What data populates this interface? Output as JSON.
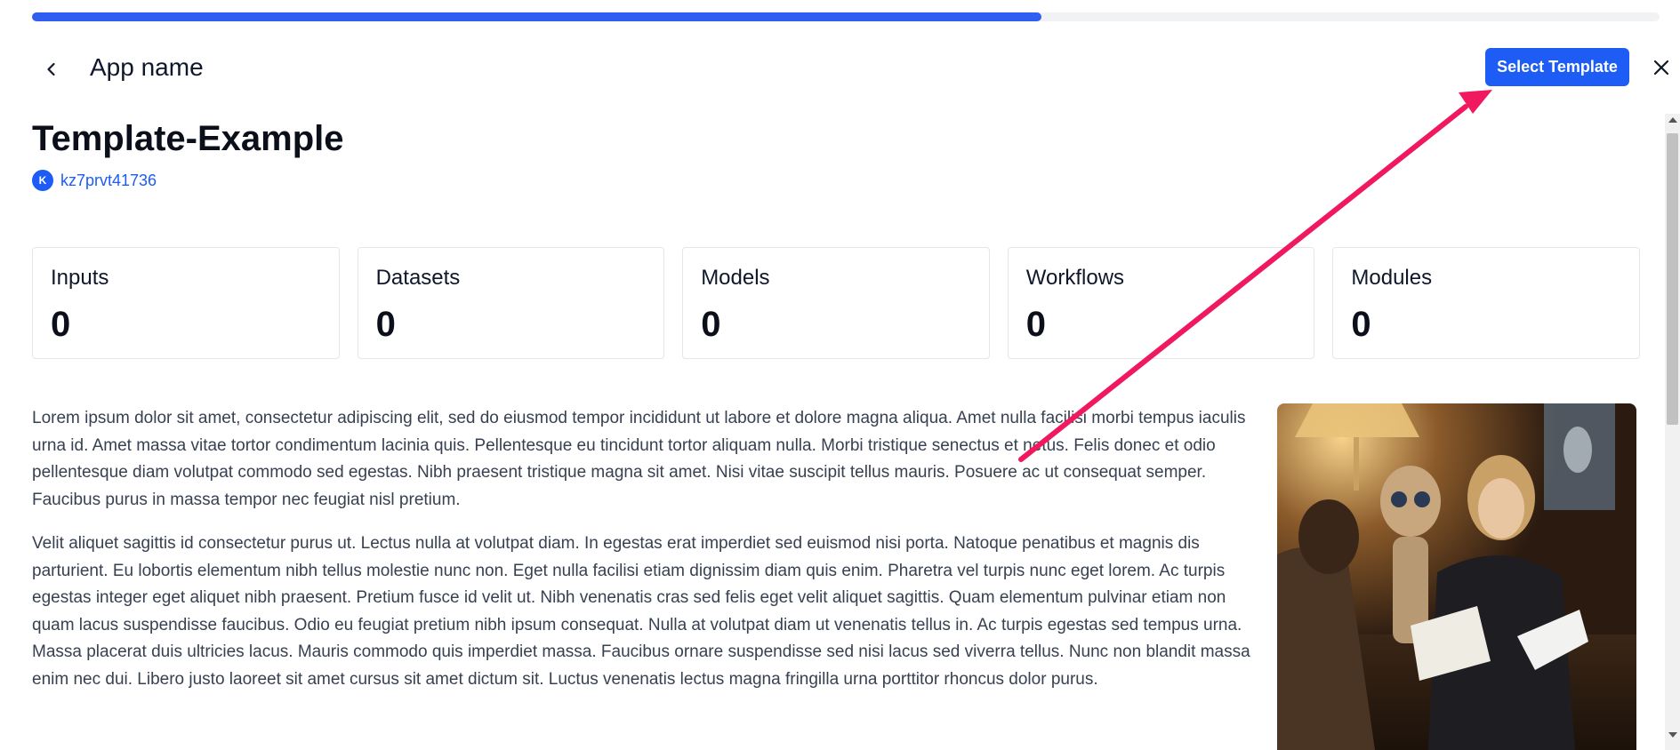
{
  "progress": {
    "percent": 62
  },
  "header": {
    "back_icon": "chevron-left-icon",
    "app_name": "App name",
    "select_template_label": "Select Template",
    "close_icon": "close-icon"
  },
  "template": {
    "title": "Template-Example",
    "owner": {
      "avatar_letter": "K",
      "name": "kz7prvt41736"
    }
  },
  "stats": [
    {
      "label": "Inputs",
      "value": "0"
    },
    {
      "label": "Datasets",
      "value": "0"
    },
    {
      "label": "Models",
      "value": "0"
    },
    {
      "label": "Workflows",
      "value": "0"
    },
    {
      "label": "Modules",
      "value": "0"
    }
  ],
  "description": [
    "Lorem ipsum dolor sit amet, consectetur adipiscing elit, sed do eiusmod tempor incididunt ut labore et dolore magna aliqua. Amet nulla facilisi morbi tempus iaculis urna id. Amet massa vitae tortor condimentum lacinia quis. Pellentesque eu tincidunt tortor aliquam nulla. Morbi tristique senectus et netus. Felis donec et odio pellentesque diam volutpat commodo sed egestas. Nibh praesent tristique magna sit amet. Nisi vitae suscipit tellus mauris. Posuere ac ut consequat semper. Faucibus purus in massa tempor nec feugiat nisl pretium.",
    "Velit aliquet sagittis id consectetur purus ut. Lectus nulla at volutpat diam. In egestas erat imperdiet sed euismod nisi porta. Natoque penatibus et magnis dis parturient. Eu lobortis elementum nibh tellus molestie nunc non. Eget nulla facilisi etiam dignissim diam quis enim. Pharetra vel turpis nunc eget lorem. Ac turpis egestas integer eget aliquet nibh praesent. Pretium fusce id velit ut. Nibh venenatis cras sed felis eget velit aliquet sagittis. Quam elementum pulvinar etiam non quam lacus suspendisse faucibus. Odio eu feugiat pretium nibh ipsum consequat. Nulla at volutpat diam ut venenatis tellus in. Ac turpis egestas sed tempus urna. Massa placerat duis ultricies lacus. Mauris commodo quis imperdiet massa. Faucibus ornare suspendisse sed nisi lacus sed viverra tellus. Nunc non blandit massa enim nec dui. Libero justo laoreet sit amet cursus sit amet dictum sit. Luctus venenatis lectus magna fringilla urna porttitor rhoncus dolor purus."
  ],
  "colors": {
    "accent": "#1d5cf5",
    "progress": "#2f5ef0",
    "annotation_arrow": "#f0185e"
  }
}
